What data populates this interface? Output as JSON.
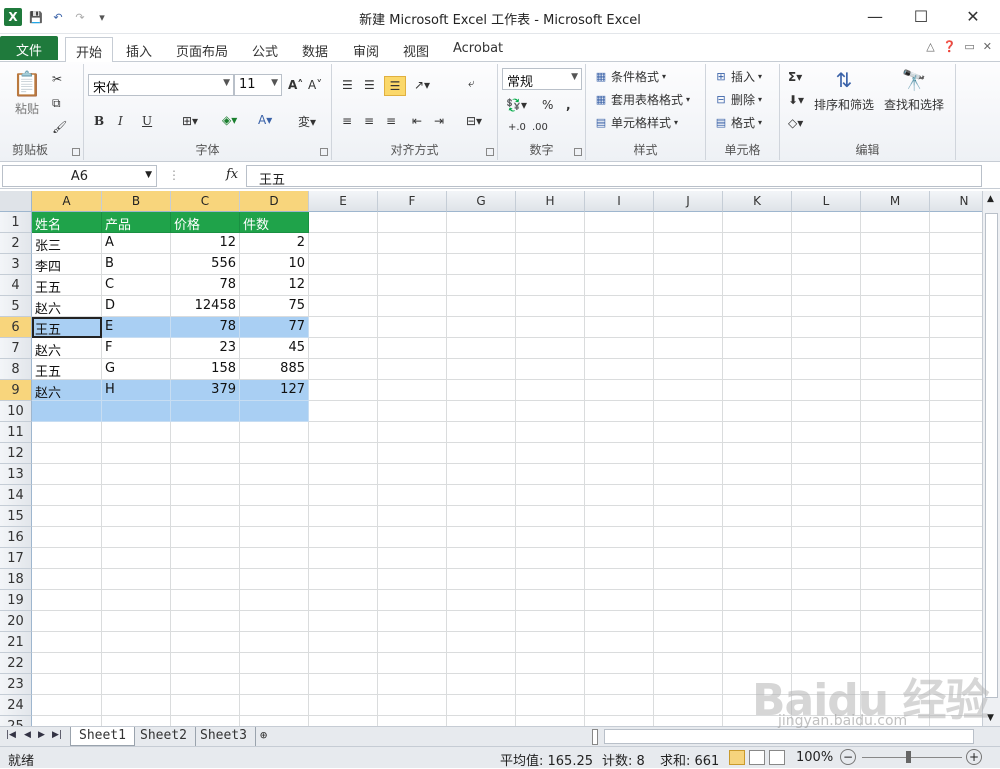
{
  "window": {
    "title": "新建 Microsoft Excel 工作表 - Microsoft Excel",
    "minimize_icon": "—",
    "maximize_icon": "☐",
    "close_icon": "✕"
  },
  "qat": {
    "app_icon": "X",
    "save_icon": "💾",
    "undo_icon": "↶",
    "redo_icon": "↷",
    "customize_icon": "▾"
  },
  "tabs": [
    {
      "label": "文件"
    },
    {
      "label": "开始"
    },
    {
      "label": "插入"
    },
    {
      "label": "页面布局"
    },
    {
      "label": "公式"
    },
    {
      "label": "数据"
    },
    {
      "label": "审阅"
    },
    {
      "label": "视图"
    },
    {
      "label": "Acrobat"
    }
  ],
  "ribbon": {
    "clipboard": {
      "label": "剪贴板",
      "paste": "粘贴"
    },
    "font": {
      "label": "字体",
      "family": "宋体",
      "size": "11",
      "bold": "B",
      "italic": "I",
      "underline": "U"
    },
    "alignment": {
      "label": "对齐方式"
    },
    "number": {
      "label": "数字",
      "format": "常规"
    },
    "styles": {
      "label": "样式",
      "conditional": "条件格式",
      "table": "套用表格格式",
      "cell": "单元格样式"
    },
    "cells": {
      "label": "单元格",
      "insert": "插入",
      "delete": "删除",
      "format": "格式"
    },
    "editing": {
      "label": "编辑",
      "sort": "排序和筛选",
      "find": "查找和选择"
    }
  },
  "formula_bar": {
    "name_box": "A6",
    "fx": "fx",
    "content": "王五"
  },
  "columns": [
    "A",
    "B",
    "C",
    "D",
    "E",
    "F",
    "G",
    "H",
    "I",
    "J",
    "K",
    "L",
    "M",
    "N"
  ],
  "rows": [
    "1",
    "2",
    "3",
    "4",
    "5",
    "6",
    "7",
    "8",
    "9",
    "10",
    "11",
    "12",
    "13",
    "14",
    "15",
    "16",
    "17",
    "18",
    "19",
    "20",
    "21",
    "22",
    "23",
    "24",
    "25"
  ],
  "table": {
    "headers": [
      "姓名",
      "产品",
      "价格",
      "件数"
    ],
    "data": [
      [
        "张三",
        "A",
        "12",
        "2"
      ],
      [
        "李四",
        "B",
        "556",
        "10"
      ],
      [
        "王五",
        "C",
        "78",
        "12"
      ],
      [
        "赵六",
        "D",
        "12458",
        "75"
      ],
      [
        "王五",
        "E",
        "78",
        "77"
      ],
      [
        "赵六",
        "F",
        "23",
        "45"
      ],
      [
        "王五",
        "G",
        "158",
        "885"
      ],
      [
        "赵六",
        "H",
        "379",
        "127"
      ]
    ]
  },
  "sheets": [
    {
      "label": "Sheet1"
    },
    {
      "label": "Sheet2"
    },
    {
      "label": "Sheet3"
    }
  ],
  "status": {
    "ready": "就绪",
    "average": "平均值: 165.25",
    "count": "计数: 8",
    "sum": "求和: 661",
    "zoom": "100%"
  },
  "watermark": {
    "logo": "Baidu 经验",
    "url": "jingyan.baidu.com"
  },
  "colors": {
    "header_green": "#1fa34a",
    "highlight_blue": "#a9cff3",
    "file_tab": "#1f7a3c"
  }
}
